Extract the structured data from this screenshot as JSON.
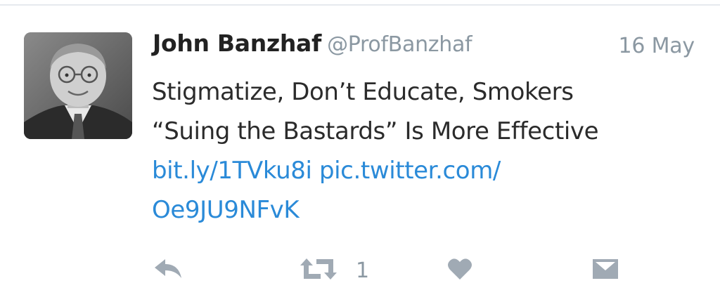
{
  "tweet": {
    "author_name": "John Banzhaf",
    "author_handle": "@ProfBanzhaf",
    "date": "16 May",
    "text_line1": "Stigmatize, Don’t Educate, Smokers",
    "text_line2": "“Suing the Bastards” Is More Effective",
    "link_short": "bit.ly/1TVku8i",
    "link_pic_part1": "pic.twitter.com/",
    "link_pic_part2": "Oe9JU9NFvK"
  },
  "actions": {
    "reply_icon": "reply-icon",
    "retweet_icon": "retweet-icon",
    "retweet_count": "1",
    "like_icon": "heart-icon",
    "dm_icon": "envelope-icon"
  },
  "colors": {
    "name": "#222222",
    "meta": "#8b98a2",
    "link": "#2a8ad8",
    "icon": "#a0aab4"
  }
}
